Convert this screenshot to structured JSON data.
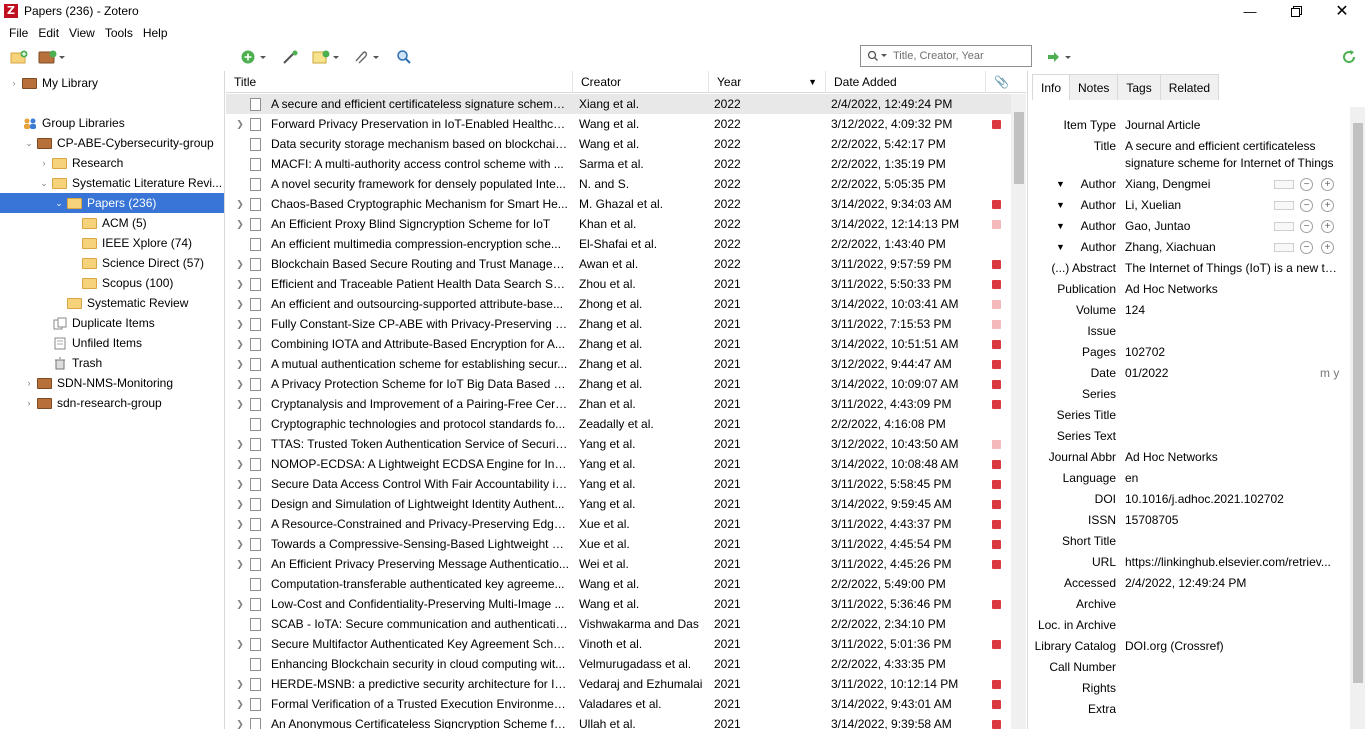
{
  "window": {
    "title": "Papers (236) - Zotero",
    "app_icon_letter": "Z"
  },
  "menu": [
    "File",
    "Edit",
    "View",
    "Tools",
    "Help"
  ],
  "search": {
    "placeholder": "Title, Creator, Year"
  },
  "tree": [
    {
      "label": "My Library",
      "level": 0,
      "icon": "library",
      "twisty": "›"
    },
    {
      "label": "Group Libraries",
      "level": 0,
      "icon": "group",
      "twisty": ""
    },
    {
      "label": "CP-ABE-Cybersecurity-group",
      "level": 0,
      "icon": "library",
      "twisty": "⌄"
    },
    {
      "label": "Research",
      "level": 1,
      "icon": "folder",
      "twisty": "›"
    },
    {
      "label": "Systematic Literature Revi...",
      "level": 1,
      "icon": "folder",
      "twisty": "⌄"
    },
    {
      "label": "Papers (236)",
      "level": 2,
      "icon": "folder",
      "twisty": "⌄",
      "selected": true
    },
    {
      "label": "ACM (5)",
      "level": 3,
      "icon": "folder",
      "twisty": ""
    },
    {
      "label": "IEEE Xplore (74)",
      "level": 3,
      "icon": "folder",
      "twisty": ""
    },
    {
      "label": "Science Direct (57)",
      "level": 3,
      "icon": "folder",
      "twisty": ""
    },
    {
      "label": "Scopus (100)",
      "level": 3,
      "icon": "folder",
      "twisty": ""
    },
    {
      "label": "Systematic Review",
      "level": 2,
      "icon": "folder",
      "twisty": ""
    },
    {
      "label": "Duplicate Items",
      "level": 1,
      "icon": "duplicate",
      "twisty": ""
    },
    {
      "label": "Unfiled Items",
      "level": 1,
      "icon": "unfiled",
      "twisty": ""
    },
    {
      "label": "Trash",
      "level": 1,
      "icon": "trash",
      "twisty": ""
    },
    {
      "label": "SDN-NMS-Monitoring",
      "level": 0,
      "icon": "library",
      "twisty": "›"
    },
    {
      "label": "sdn-research-group",
      "level": 0,
      "icon": "library",
      "twisty": "›"
    }
  ],
  "columns": {
    "title": "Title",
    "creator": "Creator",
    "year": "Year",
    "date_added": "Date Added"
  },
  "items": [
    {
      "title": "A secure and efficient certificateless signature scheme ...",
      "creator": "Xiang et al.",
      "year": "2022",
      "date": "2/4/2022, 12:49:24 PM",
      "expand": false,
      "pdf": "none",
      "selected": true
    },
    {
      "title": "Forward Privacy Preservation in IoT-Enabled Healthcar...",
      "creator": "Wang et al.",
      "year": "2022",
      "date": "3/12/2022, 4:09:32 PM",
      "expand": true,
      "pdf": "on"
    },
    {
      "title": "Data security storage mechanism based on blockchain...",
      "creator": "Wang et al.",
      "year": "2022",
      "date": "2/2/2022, 5:42:17 PM",
      "expand": false,
      "pdf": "none"
    },
    {
      "title": "MACFI: A multi-authority access control scheme with ...",
      "creator": "Sarma et al.",
      "year": "2022",
      "date": "2/2/2022, 1:35:19 PM",
      "expand": false,
      "pdf": "none"
    },
    {
      "title": "A novel security framework for densely populated Inte...",
      "creator": "N. and S.",
      "year": "2022",
      "date": "2/2/2022, 5:05:35 PM",
      "expand": false,
      "pdf": "none"
    },
    {
      "title": "Chaos-Based Cryptographic Mechanism for Smart He...",
      "creator": "M. Ghazal et al.",
      "year": "2022",
      "date": "3/14/2022, 9:34:03 AM",
      "expand": true,
      "pdf": "on"
    },
    {
      "title": "An Efficient Proxy Blind Signcryption Scheme for IoT",
      "creator": "Khan et al.",
      "year": "2022",
      "date": "3/14/2022, 12:14:13 PM",
      "expand": true,
      "pdf": "off"
    },
    {
      "title": "An efficient multimedia compression-encryption sche...",
      "creator": "El-Shafai et al.",
      "year": "2022",
      "date": "2/2/2022, 1:43:40 PM",
      "expand": false,
      "pdf": "none"
    },
    {
      "title": "Blockchain Based Secure Routing and Trust Managem...",
      "creator": "Awan et al.",
      "year": "2022",
      "date": "3/11/2022, 9:57:59 PM",
      "expand": true,
      "pdf": "on"
    },
    {
      "title": "Efficient and Traceable Patient Health Data Search Syst...",
      "creator": "Zhou et al.",
      "year": "2021",
      "date": "3/11/2022, 5:50:33 PM",
      "expand": true,
      "pdf": "on"
    },
    {
      "title": "An efficient and outsourcing-supported attribute-base...",
      "creator": "Zhong et al.",
      "year": "2021",
      "date": "3/14/2022, 10:03:41 AM",
      "expand": true,
      "pdf": "off"
    },
    {
      "title": "Fully Constant-Size CP-ABE with Privacy-Preserving O...",
      "creator": "Zhang et al.",
      "year": "2021",
      "date": "3/11/2022, 7:15:53 PM",
      "expand": true,
      "pdf": "off"
    },
    {
      "title": "Combining IOTA and Attribute-Based Encryption for A...",
      "creator": "Zhang et al.",
      "year": "2021",
      "date": "3/14/2022, 10:51:51 AM",
      "expand": true,
      "pdf": "on"
    },
    {
      "title": "A mutual authentication scheme for establishing secur...",
      "creator": "Zhang et al.",
      "year": "2021",
      "date": "3/12/2022, 9:44:47 AM",
      "expand": true,
      "pdf": "on"
    },
    {
      "title": "A Privacy Protection Scheme for IoT Big Data Based on...",
      "creator": "Zhang et al.",
      "year": "2021",
      "date": "3/14/2022, 10:09:07 AM",
      "expand": true,
      "pdf": "on"
    },
    {
      "title": "Cryptanalysis and Improvement of a Pairing-Free Certi...",
      "creator": "Zhan et al.",
      "year": "2021",
      "date": "3/11/2022, 4:43:09 PM",
      "expand": true,
      "pdf": "on"
    },
    {
      "title": "Cryptographic technologies and protocol standards fo...",
      "creator": "Zeadally et al.",
      "year": "2021",
      "date": "2/2/2022, 4:16:08 PM",
      "expand": false,
      "pdf": "none"
    },
    {
      "title": "TTAS: Trusted Token Authentication Service of Securing...",
      "creator": "Yang et al.",
      "year": "2021",
      "date": "3/12/2022, 10:43:50 AM",
      "expand": true,
      "pdf": "off"
    },
    {
      "title": "NOMOP-ECDSA: A Lightweight ECDSA Engine for Inte...",
      "creator": "Yang et al.",
      "year": "2021",
      "date": "3/14/2022, 10:08:48 AM",
      "expand": true,
      "pdf": "on"
    },
    {
      "title": "Secure Data Access Control With Fair Accountability in...",
      "creator": "Yang et al.",
      "year": "2021",
      "date": "3/11/2022, 5:58:45 PM",
      "expand": true,
      "pdf": "on"
    },
    {
      "title": "Design and Simulation of Lightweight Identity Authent...",
      "creator": "Yang et al.",
      "year": "2021",
      "date": "3/14/2022, 9:59:45 AM",
      "expand": true,
      "pdf": "on"
    },
    {
      "title": "A Resource-Constrained and Privacy-Preserving Edge-...",
      "creator": "Xue et al.",
      "year": "2021",
      "date": "3/11/2022, 4:43:37 PM",
      "expand": true,
      "pdf": "on"
    },
    {
      "title": "Towards a Compressive-Sensing-Based Lightweight En...",
      "creator": "Xue et al.",
      "year": "2021",
      "date": "3/11/2022, 4:45:54 PM",
      "expand": true,
      "pdf": "on"
    },
    {
      "title": "An Efficient Privacy Preserving Message Authenticatio...",
      "creator": "Wei et al.",
      "year": "2021",
      "date": "3/11/2022, 4:45:26 PM",
      "expand": true,
      "pdf": "on"
    },
    {
      "title": "Computation-transferable authenticated key agreeme...",
      "creator": "Wang et al.",
      "year": "2021",
      "date": "2/2/2022, 5:49:00 PM",
      "expand": false,
      "pdf": "none"
    },
    {
      "title": "Low-Cost and Confidentiality-Preserving Multi-Image ...",
      "creator": "Wang et al.",
      "year": "2021",
      "date": "3/11/2022, 5:36:46 PM",
      "expand": true,
      "pdf": "on"
    },
    {
      "title": "SCAB - IoTA: Secure communication and authenticatio...",
      "creator": "Vishwakarma and Das",
      "year": "2021",
      "date": "2/2/2022, 2:34:10 PM",
      "expand": false,
      "pdf": "none"
    },
    {
      "title": "Secure Multifactor Authenticated Key Agreement Sche...",
      "creator": "Vinoth et al.",
      "year": "2021",
      "date": "3/11/2022, 5:01:36 PM",
      "expand": true,
      "pdf": "on"
    },
    {
      "title": "Enhancing Blockchain security in cloud computing wit...",
      "creator": "Velmurugadass et al.",
      "year": "2021",
      "date": "2/2/2022, 4:33:35 PM",
      "expand": false,
      "pdf": "none"
    },
    {
      "title": "HERDE-MSNB: a predictive security architecture for IoT...",
      "creator": "Vedaraj and Ezhumalai",
      "year": "2021",
      "date": "3/11/2022, 10:12:14 PM",
      "expand": true,
      "pdf": "on"
    },
    {
      "title": "Formal Verification of a Trusted Execution Environmen...",
      "creator": "Valadares et al.",
      "year": "2021",
      "date": "3/14/2022, 9:43:01 AM",
      "expand": true,
      "pdf": "on"
    },
    {
      "title": "An Anonymous Certificateless Signcryption Scheme fo...",
      "creator": "Ullah et al.",
      "year": "2021",
      "date": "3/14/2022, 9:39:58 AM",
      "expand": true,
      "pdf": "on"
    }
  ],
  "tabs": [
    "Info",
    "Notes",
    "Tags",
    "Related"
  ],
  "info": {
    "item_type": {
      "label": "Item Type",
      "value": "Journal Article"
    },
    "title": {
      "label": "Title",
      "value_line1": "A secure and efficient certificateless",
      "value_line2": "signature scheme for Internet of Things"
    },
    "authors": [
      {
        "label": "Author",
        "value": "Xiang, Dengmei"
      },
      {
        "label": "Author",
        "value": "Li, Xuelian"
      },
      {
        "label": "Author",
        "value": "Gao, Juntao"
      },
      {
        "label": "Author",
        "value": "Zhang, Xiachuan"
      }
    ],
    "abstract": {
      "label": "(...) Abstract",
      "value": "The Internet of Things (IoT) is a new tec..."
    },
    "fields": [
      {
        "label": "Publication",
        "value": "Ad Hoc Networks"
      },
      {
        "label": "Volume",
        "value": "124"
      },
      {
        "label": "Issue",
        "value": ""
      },
      {
        "label": "Pages",
        "value": "102702"
      },
      {
        "label": "Date",
        "value": "01/2022",
        "extra": "m y"
      },
      {
        "label": "Series",
        "value": ""
      },
      {
        "label": "Series Title",
        "value": ""
      },
      {
        "label": "Series Text",
        "value": ""
      },
      {
        "label": "Journal Abbr",
        "value": "Ad Hoc Networks"
      },
      {
        "label": "Language",
        "value": "en"
      },
      {
        "label": "DOI",
        "value": "10.1016/j.adhoc.2021.102702"
      },
      {
        "label": "ISSN",
        "value": "15708705"
      },
      {
        "label": "Short Title",
        "value": ""
      },
      {
        "label": "URL",
        "value": "https://linkinghub.elsevier.com/retriev..."
      },
      {
        "label": "Accessed",
        "value": "2/4/2022, 12:49:24 PM"
      },
      {
        "label": "Archive",
        "value": ""
      },
      {
        "label": "Loc. in Archive",
        "value": ""
      },
      {
        "label": "Library Catalog",
        "value": "DOI.org (Crossref)"
      },
      {
        "label": "Call Number",
        "value": ""
      },
      {
        "label": "Rights",
        "value": ""
      },
      {
        "label": "Extra",
        "value": ""
      }
    ]
  },
  "colors": {
    "selection": "#3875d7",
    "pdf_icon": "#d9393f",
    "library_folder": "#b8703b",
    "collection_folder": "#f6d37b"
  }
}
